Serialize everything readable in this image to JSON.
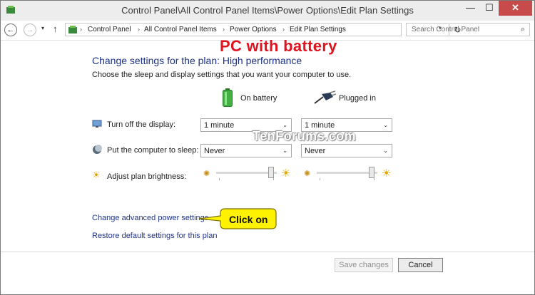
{
  "window": {
    "title": "Control Panel\\All Control Panel Items\\Power Options\\Edit Plan Settings",
    "minimize_glyph": "—",
    "maximize_glyph": "☐",
    "close_glyph": "✕"
  },
  "navbar": {
    "back_glyph": "←",
    "forward_glyph": "→",
    "recent_glyph": "▾",
    "up_glyph": "↑",
    "breadcrumbs": [
      "Control Panel",
      "All Control Panel Items",
      "Power Options",
      "Edit Plan Settings"
    ],
    "separator": "›",
    "dropdown_glyph": "▾",
    "refresh_glyph": "↻",
    "search_placeholder": "Search Control Panel",
    "search_glyph": "⌕"
  },
  "main": {
    "heading": "Change settings for the plan: High performance",
    "subtext": "Choose the sleep and display settings that you want your computer to use.",
    "columns": {
      "battery": "On battery",
      "plugged": "Plugged in"
    },
    "rows": {
      "display": {
        "label": "Turn off the display:",
        "battery_value": "1 minute",
        "plugged_value": "1 minute"
      },
      "sleep": {
        "label": "Put the computer to sleep:",
        "battery_value": "Never",
        "plugged_value": "Never"
      },
      "brightness": {
        "label": "Adjust plan brightness:",
        "battery_level": 0.9,
        "plugged_level": 0.9
      }
    },
    "select_arrow": "⌄",
    "sun_small": "✺",
    "sun_big": "☀",
    "links": {
      "advanced": "Change advanced power settings",
      "restore": "Restore default settings for this plan"
    }
  },
  "overlay": {
    "title": "PC with battery",
    "callout": "Click on",
    "watermark": "TenForums.com"
  },
  "footer": {
    "save": "Save changes",
    "cancel": "Cancel"
  },
  "colors": {
    "accent_link": "#1e3287",
    "close_button": "#c74b4b",
    "overlay_red": "#e0141e",
    "callout_yellow": "#fff200"
  }
}
